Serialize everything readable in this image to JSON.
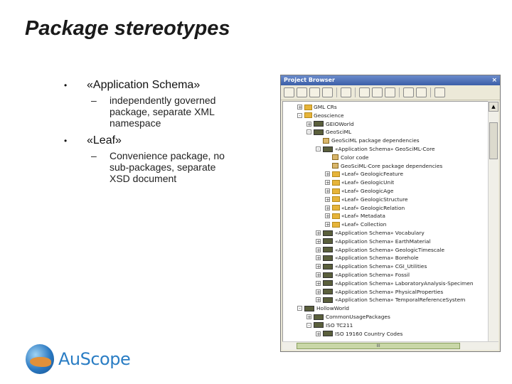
{
  "slide": {
    "title": "Package stereotypes",
    "bullets": [
      {
        "marker": "•",
        "label": "«Application Schema»",
        "sub": "independently governed package, separate XML namespace"
      },
      {
        "marker": "•",
        "label": "«Leaf»",
        "sub": "Convenience package, no sub-packages, separate XSD document"
      }
    ],
    "sub_marker": "–"
  },
  "browser": {
    "title": "Project Browser",
    "close": "×",
    "toolbar_icons": [
      "new-package-icon",
      "new-folder-icon",
      "new-diagram-icon",
      "new-element-icon",
      "sep",
      "find-icon",
      "sep",
      "properties-icon",
      "generate-icon",
      "dropdown-icon",
      "sep",
      "move-up-icon",
      "move-down-icon",
      "sep",
      "help-icon"
    ],
    "tree": [
      {
        "indent": 0,
        "expander": "+",
        "icon": "folder",
        "label": "GML CRs"
      },
      {
        "indent": 0,
        "expander": "-",
        "icon": "folder",
        "label": "Geoscience"
      },
      {
        "indent": 1,
        "expander": "+",
        "icon": "class",
        "label": "GEIOWorld"
      },
      {
        "indent": 1,
        "expander": "-",
        "icon": "class",
        "label": "GeoSciML"
      },
      {
        "indent": 2,
        "expander": "",
        "icon": "pkg",
        "label": "GeoSciML package dependencies"
      },
      {
        "indent": 2,
        "expander": "-",
        "icon": "class",
        "label": "«Application Schema» GeoSciML-Core"
      },
      {
        "indent": 3,
        "expander": "",
        "icon": "pkg",
        "label": "Color code"
      },
      {
        "indent": 3,
        "expander": "",
        "icon": "pkg",
        "label": "GeoSciML-Core package dependencies"
      },
      {
        "indent": 3,
        "expander": "+",
        "icon": "folder",
        "label": "«Leaf» GeologicFeature"
      },
      {
        "indent": 3,
        "expander": "+",
        "icon": "folder",
        "label": "«Leaf» GeologicUnit"
      },
      {
        "indent": 3,
        "expander": "+",
        "icon": "folder",
        "label": "«Leaf» GeologicAge"
      },
      {
        "indent": 3,
        "expander": "+",
        "icon": "folder",
        "label": "«Leaf» GeologicStructure"
      },
      {
        "indent": 3,
        "expander": "+",
        "icon": "folder",
        "label": "«Leaf» GeologicRelation"
      },
      {
        "indent": 3,
        "expander": "+",
        "icon": "folder",
        "label": "«Leaf» Metadata"
      },
      {
        "indent": 3,
        "expander": "+",
        "icon": "folder",
        "label": "«Leaf» Collection"
      },
      {
        "indent": 2,
        "expander": "+",
        "icon": "class",
        "label": "«Application Schema» Vocabulary"
      },
      {
        "indent": 2,
        "expander": "+",
        "icon": "class",
        "label": "«Application Schema» EarthMaterial"
      },
      {
        "indent": 2,
        "expander": "+",
        "icon": "class",
        "label": "«Application Schema» GeologicTimescale"
      },
      {
        "indent": 2,
        "expander": "+",
        "icon": "class",
        "label": "«Application Schema» Borehole"
      },
      {
        "indent": 2,
        "expander": "+",
        "icon": "class",
        "label": "«Application Schema» CGI_Utilities"
      },
      {
        "indent": 2,
        "expander": "+",
        "icon": "class",
        "label": "«Application Schema» Fossil"
      },
      {
        "indent": 2,
        "expander": "+",
        "icon": "class",
        "label": "«Application Schema» LaboratoryAnalysis-Specimen"
      },
      {
        "indent": 2,
        "expander": "+",
        "icon": "class",
        "label": "«Application Schema» PhysicalProperties"
      },
      {
        "indent": 2,
        "expander": "+",
        "icon": "class",
        "label": "«Application Schema» TemporalReferenceSystem"
      },
      {
        "indent": 0,
        "expander": "-",
        "icon": "class",
        "label": "HollowWorld"
      },
      {
        "indent": 1,
        "expander": "+",
        "icon": "class",
        "label": "CommonUsagePackages"
      },
      {
        "indent": 1,
        "expander": "-",
        "icon": "class",
        "label": "ISO TC211"
      },
      {
        "indent": 2,
        "expander": "+",
        "icon": "class",
        "label": "ISO 19160 Country Codes"
      }
    ],
    "hscroll_label": "III"
  },
  "logo": {
    "text": "AuScope"
  },
  "colors": {
    "title_bar": "#3c5fa8",
    "folder": "#e6b43a",
    "logo_blue": "#2a7dc4"
  }
}
